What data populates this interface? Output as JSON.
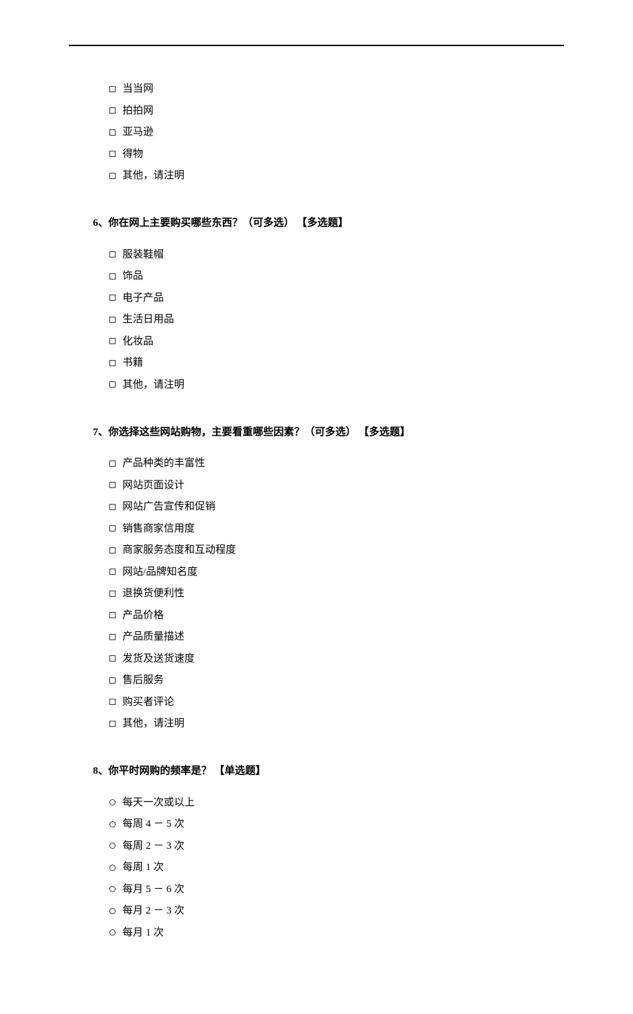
{
  "previousQuestion": {
    "options": [
      "当当网",
      "拍拍网",
      "亚马逊",
      "得物",
      "其他，请注明"
    ]
  },
  "question6": {
    "title": "6、你在网上主要购买哪些东西？（可多选） 【多选题】",
    "options": [
      "服装鞋帽",
      "饰品",
      "电子产品",
      "生活日用品",
      "化妆品",
      "书籍",
      "其他，请注明"
    ]
  },
  "question7": {
    "title": "7、你选择这些网站购物，主要看重哪些因素？（可多选） 【多选题】",
    "options": [
      "产品种类的丰富性",
      "网站页面设计",
      "网站广告宣传和促销",
      "销售商家信用度",
      "商家服务态度和互动程度",
      "网站/品牌知名度",
      "退换货便利性",
      "产品价格",
      "产品质量描述",
      "发货及送货速度",
      "售后服务",
      "购买者评论",
      "其他，请注明"
    ]
  },
  "question8": {
    "title": "8、你平时网购的频率是？ 【单选题】",
    "options": [
      "每天一次或以上",
      "每周 4 － 5 次",
      "每周 2 － 3 次",
      "每周 1 次",
      "每月 5 － 6 次",
      "每月 2 － 3 次",
      "每月 1 次"
    ]
  }
}
